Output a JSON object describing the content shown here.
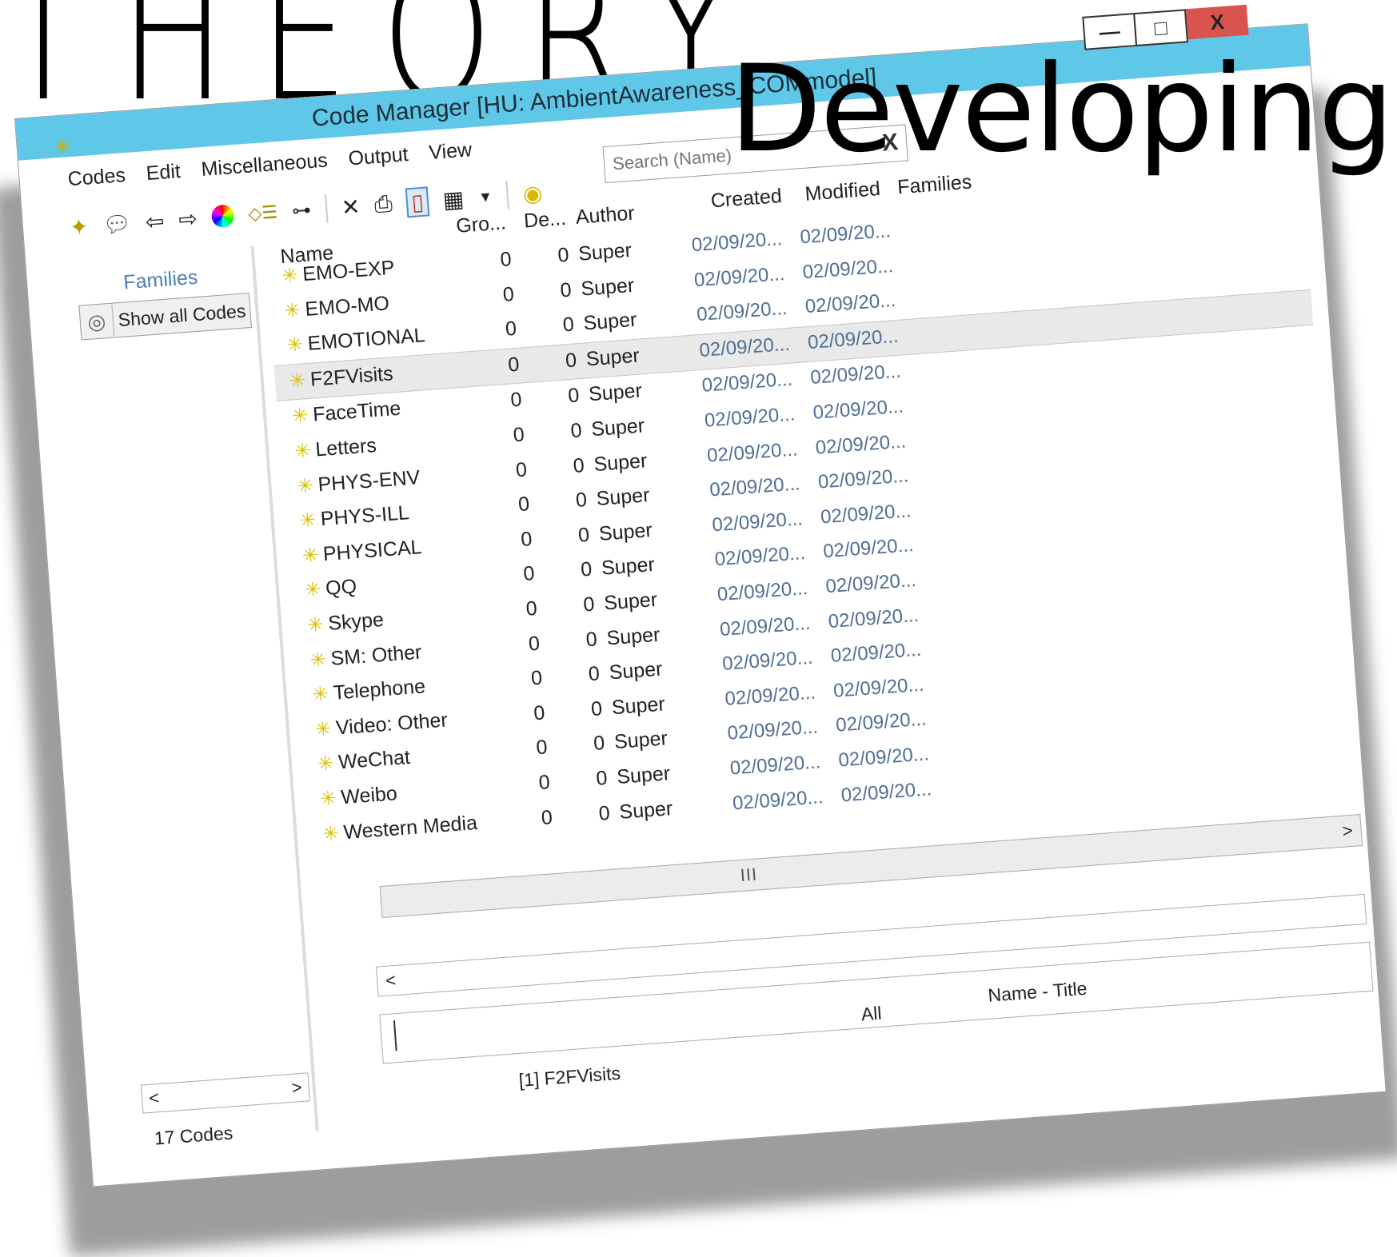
{
  "headline": {
    "word1": "THEORY",
    "word2": "Developing"
  },
  "window": {
    "title": "Code Manager [HU: AmbientAwareness_COMmodel]",
    "controls": {
      "minimize": "—",
      "maximize": "□",
      "close": "X"
    }
  },
  "menu": [
    "Codes",
    "Edit",
    "Miscellaneous",
    "Output",
    "View"
  ],
  "toolbar": {
    "icons": [
      "new-code-icon",
      "comment-icon",
      "arrow-left-icon",
      "arrow-right-icon",
      "color-wheel-icon",
      "code-list-icon",
      "tree-icon",
      "delete-icon",
      "print-icon",
      "split-view-icon",
      "grid-view-icon",
      "dropdown-icon",
      "filter-icon"
    ]
  },
  "search": {
    "placeholder": "Search (Name)",
    "clear": "X"
  },
  "sidebar": {
    "title": "Families",
    "button_label": "Show all Codes",
    "scroll_left": "<",
    "scroll_right": ">",
    "count": "17 Codes"
  },
  "table": {
    "columns": {
      "name": "Name",
      "gro": "Gro...",
      "de": "De...",
      "author": "Author",
      "created": "Created",
      "modified": "Modified",
      "families": "Families"
    },
    "rows": [
      {
        "name": "EMO-EXP",
        "gro": "0",
        "de": "0",
        "author": "Super",
        "created": "02/09/20...",
        "modified": "02/09/20..."
      },
      {
        "name": "EMO-MO",
        "gro": "0",
        "de": "0",
        "author": "Super",
        "created": "02/09/20...",
        "modified": "02/09/20..."
      },
      {
        "name": "EMOTIONAL",
        "gro": "0",
        "de": "0",
        "author": "Super",
        "created": "02/09/20...",
        "modified": "02/09/20..."
      },
      {
        "name": "F2FVisits",
        "gro": "0",
        "de": "0",
        "author": "Super",
        "created": "02/09/20...",
        "modified": "02/09/20..."
      },
      {
        "name": "FaceTime",
        "gro": "0",
        "de": "0",
        "author": "Super",
        "created": "02/09/20...",
        "modified": "02/09/20..."
      },
      {
        "name": "Letters",
        "gro": "0",
        "de": "0",
        "author": "Super",
        "created": "02/09/20...",
        "modified": "02/09/20..."
      },
      {
        "name": "PHYS-ENV",
        "gro": "0",
        "de": "0",
        "author": "Super",
        "created": "02/09/20...",
        "modified": "02/09/20..."
      },
      {
        "name": "PHYS-ILL",
        "gro": "0",
        "de": "0",
        "author": "Super",
        "created": "02/09/20...",
        "modified": "02/09/20..."
      },
      {
        "name": "PHYSICAL",
        "gro": "0",
        "de": "0",
        "author": "Super",
        "created": "02/09/20...",
        "modified": "02/09/20..."
      },
      {
        "name": "QQ",
        "gro": "0",
        "de": "0",
        "author": "Super",
        "created": "02/09/20...",
        "modified": "02/09/20..."
      },
      {
        "name": "Skype",
        "gro": "0",
        "de": "0",
        "author": "Super",
        "created": "02/09/20...",
        "modified": "02/09/20..."
      },
      {
        "name": "SM: Other",
        "gro": "0",
        "de": "0",
        "author": "Super",
        "created": "02/09/20...",
        "modified": "02/09/20..."
      },
      {
        "name": "Telephone",
        "gro": "0",
        "de": "0",
        "author": "Super",
        "created": "02/09/20...",
        "modified": "02/09/20..."
      },
      {
        "name": "Video: Other",
        "gro": "0",
        "de": "0",
        "author": "Super",
        "created": "02/09/20...",
        "modified": "02/09/20..."
      },
      {
        "name": "WeChat",
        "gro": "0",
        "de": "0",
        "author": "Super",
        "created": "02/09/20...",
        "modified": "02/09/20..."
      },
      {
        "name": "Weibo",
        "gro": "0",
        "de": "0",
        "author": "Super",
        "created": "02/09/20...",
        "modified": "02/09/20..."
      },
      {
        "name": "Western Media",
        "gro": "0",
        "de": "0",
        "author": "Super",
        "created": "02/09/20...",
        "modified": "02/09/20..."
      }
    ],
    "selected_index": 3
  },
  "scrollbars": {
    "right_arrow": ">",
    "left_arrow": "<",
    "grip": "III"
  },
  "bottom": {
    "all_label": "All",
    "name_title_label": "Name - Title",
    "selection_status": "[1] F2FVisits"
  },
  "colors": {
    "titlebar": "#5fc8e8",
    "close_button": "#d9534f",
    "link_blue": "#4f7fb6",
    "code_star": "#d7c200"
  }
}
